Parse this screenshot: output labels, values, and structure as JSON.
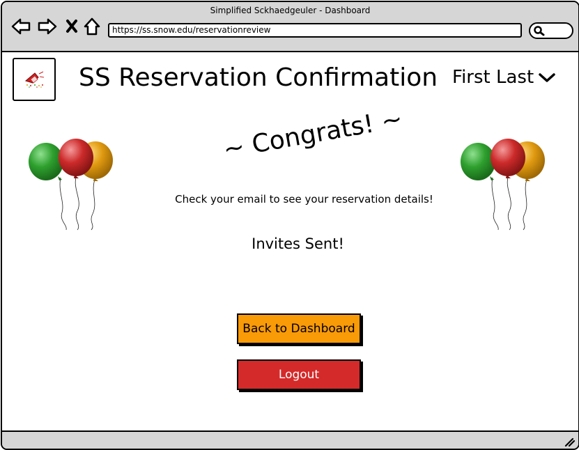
{
  "window": {
    "title": "Simplified Sckhaedgeuler - Dashboard"
  },
  "browser": {
    "url": "https://ss.snow.edu/reservationreview",
    "nav_icons": [
      "back-arrow-icon",
      "forward-arrow-icon",
      "close-x-icon",
      "home-icon"
    ],
    "search_icon": "search-icon"
  },
  "header": {
    "title": "SS Reservation Confirmation",
    "user_name": "First Last",
    "user_menu_icon": "chevron-down-icon"
  },
  "main": {
    "congrats": "~ Congrats! ~",
    "email_message": "Check your email to see your reservation details!",
    "invites_status": "Invites Sent!"
  },
  "actions": {
    "back_label": "Back to Dashboard",
    "logout_label": "Logout"
  },
  "colors": {
    "chrome_bg": "#d6d6d6",
    "back_button": "#f99a07",
    "logout_button": "#d42a2a",
    "balloon_green": "#2ea02e",
    "balloon_red": "#cc2a2a",
    "balloon_orange": "#e09a10"
  }
}
